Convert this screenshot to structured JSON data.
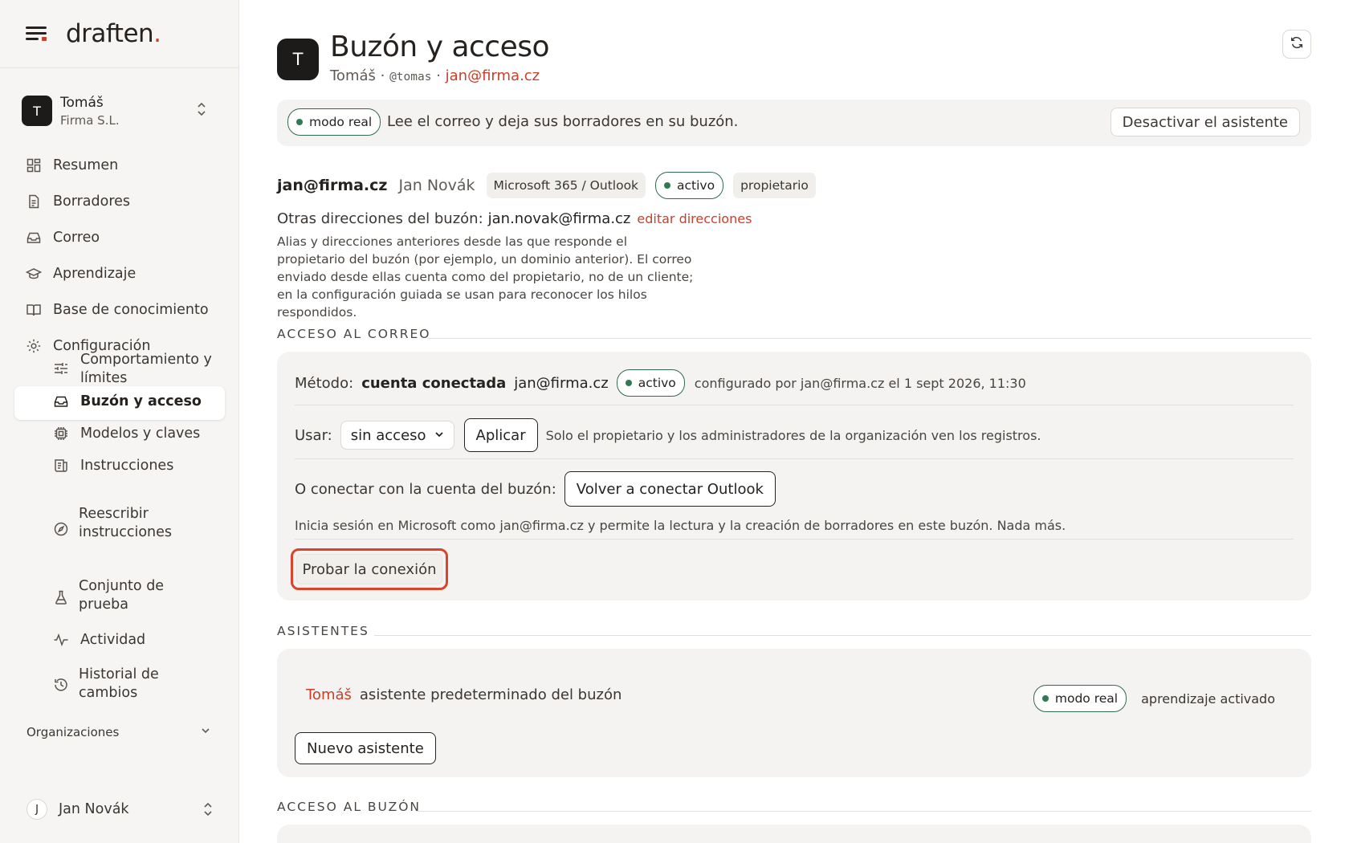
{
  "brand": {
    "name": "draften",
    "dot": "."
  },
  "account": {
    "initial": "T",
    "name": "Tomáš",
    "org": "Firma S.L."
  },
  "nav": {
    "resumen": "Resumen",
    "borradores": "Borradores",
    "correo": "Correo",
    "aprendizaje": "Aprendizaje",
    "base": "Base de conocimiento",
    "config": "Configuración"
  },
  "subnav": {
    "comportamiento_1": "Comportamiento y",
    "comportamiento_2": "límites",
    "buzon": "Buzón y acceso",
    "modelos": "Modelos y claves",
    "instrucciones": "Instrucciones",
    "reescribir_1": "Reescribir",
    "reescribir_2": "instrucciones",
    "conjunto_1": "Conjunto de",
    "conjunto_2": "prueba",
    "actividad": "Actividad",
    "historial_1": "Historial de",
    "historial_2": "cambios"
  },
  "organizations_label": "Organizaciones",
  "user": {
    "initial": "J",
    "name": "Jan Novák"
  },
  "page": {
    "avatar": "T",
    "title": "Buzón y acceso",
    "owner": "Tomáš",
    "sep1": " · ",
    "handle": "@tomas",
    "sep2": " · ",
    "email": "jan@firma.cz"
  },
  "mode_bar": {
    "pill": "modo real",
    "text": "Lee el correo y deja sus borradores en su buzón.",
    "button": "Desactivar el asistente"
  },
  "mailbox": {
    "email": "jan@firma.cz",
    "name": "Jan Novák",
    "provider": "Microsoft 365 / Outlook",
    "status": "activo",
    "role": "propietario",
    "other_label": "Otras direcciones del buzón:",
    "other_value": "jan.novak@firma.cz",
    "edit_link": "editar direcciones",
    "description": "Alias y direcciones anteriores desde las que responde el propietario del buzón (por ejemplo, un dominio anterior). El correo enviado desde ellas cuenta como del propietario, no de un cliente; en la configuración guiada se usan para reconocer los hilos respondidos."
  },
  "mail_access": {
    "section": "ACCESO AL CORREO",
    "method_label": "Método:",
    "method_value": "cuenta conectada",
    "method_email": "jan@firma.cz",
    "status": "activo",
    "configured": "configurado por jan@firma.cz el 1 sept 2026, 11:30",
    "use_label": "Usar:",
    "use_value": "sin acceso",
    "apply": "Aplicar",
    "use_hint": "Solo el propietario y los administradores de la organización ven los registros.",
    "connect_label": "O conectar con la cuenta del buzón:",
    "reconnect": "Volver a conectar Outlook",
    "connect_desc": "Inicia sesión en Microsoft como jan@firma.cz y permite la lectura y la creación de borradores en este buzón. Nada más.",
    "test": "Probar la conexión"
  },
  "assistants": {
    "section": "ASISTENTES",
    "name": "Tomáš",
    "desc": "asistente predeterminado del buzón",
    "mode": "modo real",
    "learning": "aprendizaje activado",
    "new_button": "Nuevo asistente"
  },
  "mailbox_access": {
    "section": "ACCESO AL BUZÓN"
  },
  "colors": {
    "accent": "#c8402c",
    "active_green": "#2f7a55",
    "highlight_ring": "#d9442c"
  }
}
